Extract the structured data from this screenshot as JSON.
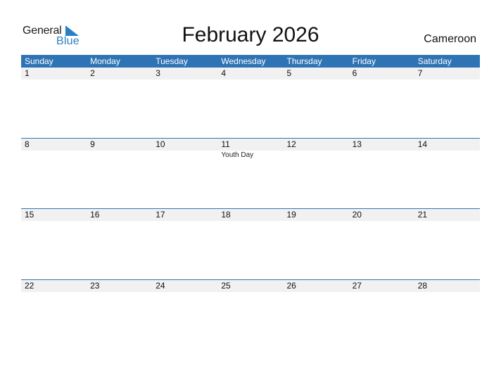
{
  "logo": {
    "line1": "General",
    "line2": "Blue",
    "icon": "triangle-flag-icon"
  },
  "title": "February 2026",
  "country": "Cameroon",
  "colors": {
    "header_bg": "#2e74b5",
    "date_strip_bg": "#f1f1f1",
    "logo_blue": "#2a7fc4"
  },
  "weekdays": [
    "Sunday",
    "Monday",
    "Tuesday",
    "Wednesday",
    "Thursday",
    "Friday",
    "Saturday"
  ],
  "weeks": [
    {
      "days": [
        {
          "num": "1",
          "event": ""
        },
        {
          "num": "2",
          "event": ""
        },
        {
          "num": "3",
          "event": ""
        },
        {
          "num": "4",
          "event": ""
        },
        {
          "num": "5",
          "event": ""
        },
        {
          "num": "6",
          "event": ""
        },
        {
          "num": "7",
          "event": ""
        }
      ]
    },
    {
      "days": [
        {
          "num": "8",
          "event": ""
        },
        {
          "num": "9",
          "event": ""
        },
        {
          "num": "10",
          "event": ""
        },
        {
          "num": "11",
          "event": "Youth Day"
        },
        {
          "num": "12",
          "event": ""
        },
        {
          "num": "13",
          "event": ""
        },
        {
          "num": "14",
          "event": ""
        }
      ]
    },
    {
      "days": [
        {
          "num": "15",
          "event": ""
        },
        {
          "num": "16",
          "event": ""
        },
        {
          "num": "17",
          "event": ""
        },
        {
          "num": "18",
          "event": ""
        },
        {
          "num": "19",
          "event": ""
        },
        {
          "num": "20",
          "event": ""
        },
        {
          "num": "21",
          "event": ""
        }
      ]
    },
    {
      "days": [
        {
          "num": "22",
          "event": ""
        },
        {
          "num": "23",
          "event": ""
        },
        {
          "num": "24",
          "event": ""
        },
        {
          "num": "25",
          "event": ""
        },
        {
          "num": "26",
          "event": ""
        },
        {
          "num": "27",
          "event": ""
        },
        {
          "num": "28",
          "event": ""
        }
      ]
    }
  ]
}
